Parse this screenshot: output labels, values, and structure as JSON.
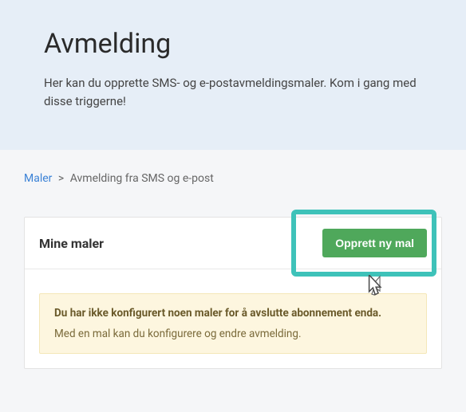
{
  "header": {
    "title": "Avmelding",
    "subtitle": "Her kan du opprette SMS- og e-postavmeldingsmaler. Kom i gang med disse triggerne!"
  },
  "breadcrumb": {
    "link_label": "Maler",
    "current": "Avmelding fra SMS og e-post",
    "separator": ">"
  },
  "panel": {
    "title": "Mine maler",
    "create_button": "Opprett ny mal"
  },
  "alert": {
    "title": "Du har ikke konfigurert noen maler for å avslutte abonnement enda.",
    "text": "Med en mal kan du konfigurere og endre avmelding."
  }
}
